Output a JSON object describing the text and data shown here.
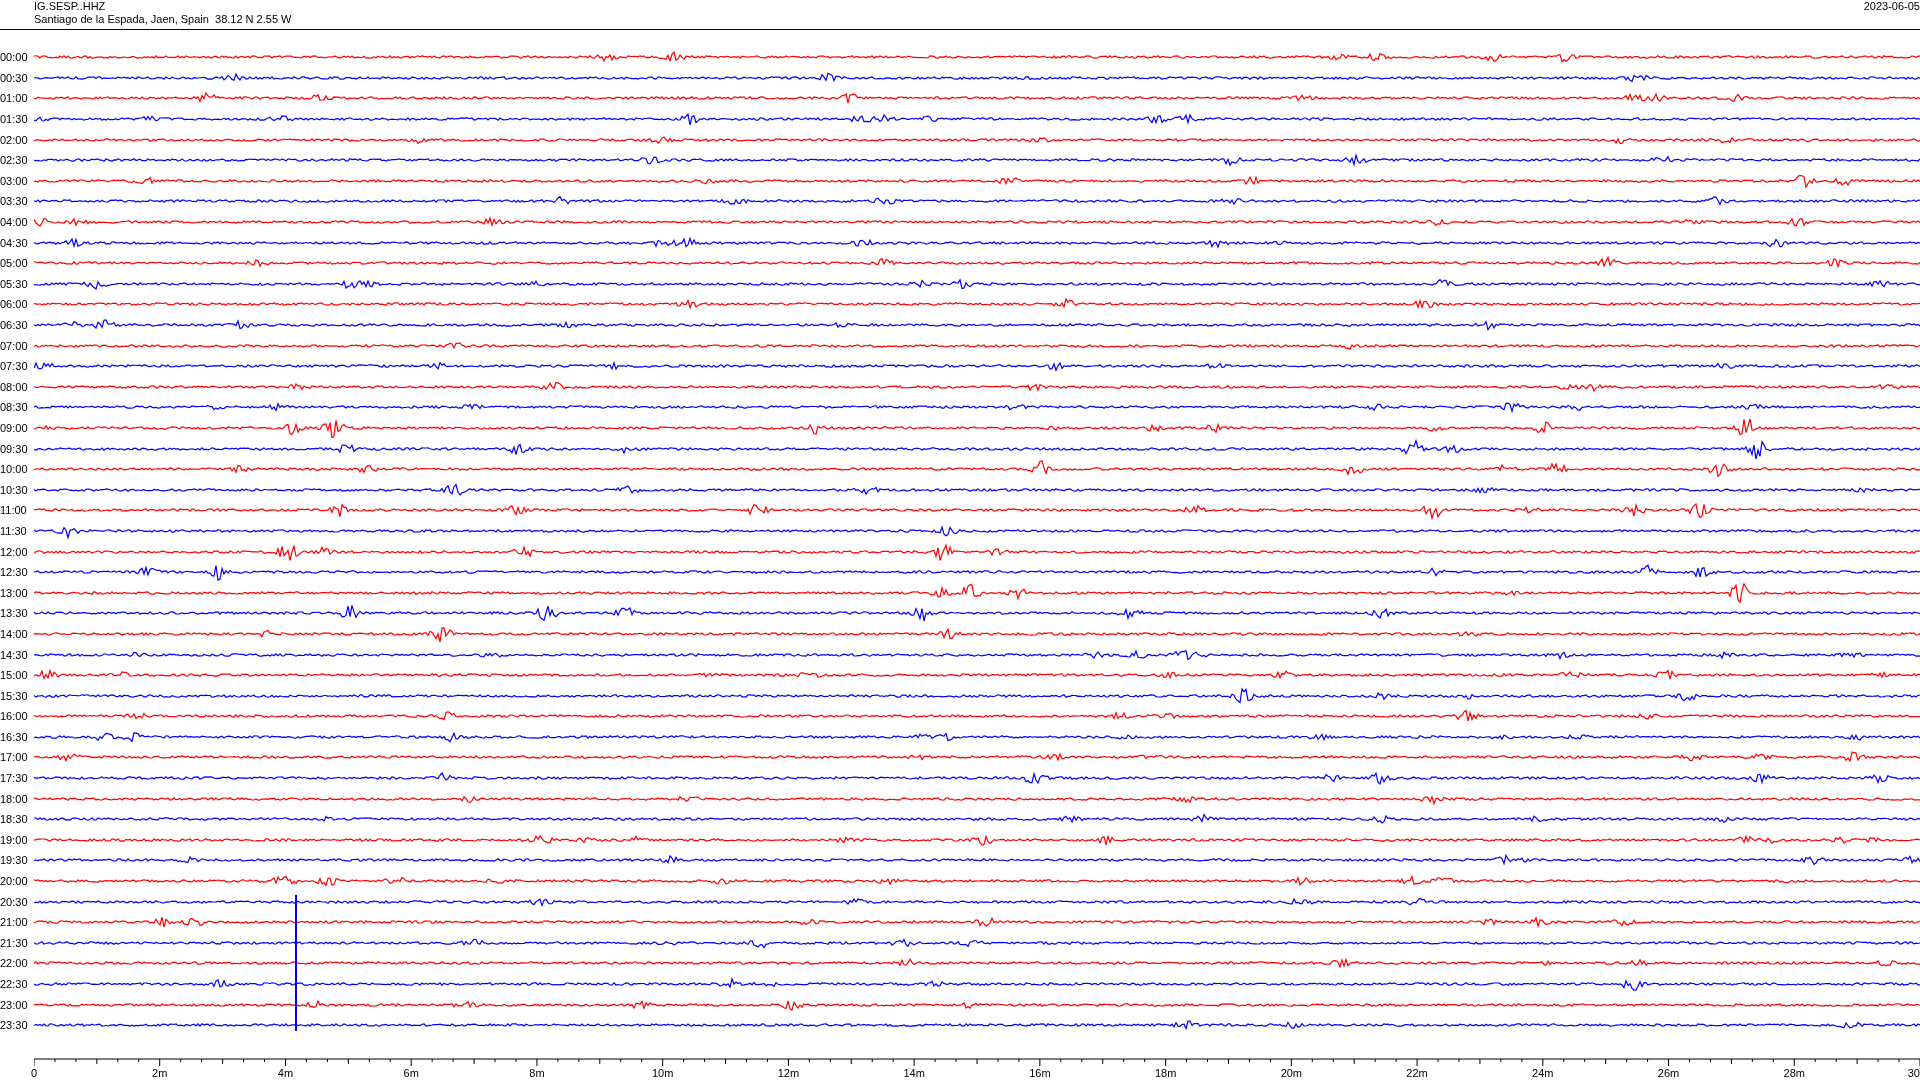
{
  "header": {
    "station": "IG.SESP..HHZ",
    "location": "Santiago de la Espada, Jaen, Spain  38.12 N 2.55 W",
    "date": "2023-06-05"
  },
  "traces": [
    {
      "label": "00:00",
      "color": "#ff0000"
    },
    {
      "label": "00:30",
      "color": "#0000ff"
    },
    {
      "label": "01:00",
      "color": "#ff0000"
    },
    {
      "label": "01:30",
      "color": "#0000ff"
    },
    {
      "label": "02:00",
      "color": "#ff0000"
    },
    {
      "label": "02:30",
      "color": "#0000ff"
    },
    {
      "label": "03:00",
      "color": "#ff0000"
    },
    {
      "label": "03:30",
      "color": "#0000ff"
    },
    {
      "label": "04:00",
      "color": "#ff0000"
    },
    {
      "label": "04:30",
      "color": "#0000ff"
    },
    {
      "label": "05:00",
      "color": "#ff0000"
    },
    {
      "label": "05:30",
      "color": "#0000ff"
    },
    {
      "label": "06:00",
      "color": "#ff0000"
    },
    {
      "label": "06:30",
      "color": "#0000ff"
    },
    {
      "label": "07:00",
      "color": "#ff0000"
    },
    {
      "label": "07:30",
      "color": "#0000ff"
    },
    {
      "label": "08:00",
      "color": "#ff0000"
    },
    {
      "label": "08:30",
      "color": "#0000ff"
    },
    {
      "label": "09:00",
      "color": "#ff0000"
    },
    {
      "label": "09:30",
      "color": "#0000ff"
    },
    {
      "label": "10:00",
      "color": "#ff0000"
    },
    {
      "label": "10:30",
      "color": "#0000ff"
    },
    {
      "label": "11:00",
      "color": "#ff0000"
    },
    {
      "label": "11:30",
      "color": "#0000ff"
    },
    {
      "label": "12:00",
      "color": "#ff0000"
    },
    {
      "label": "12:30",
      "color": "#0000ff"
    },
    {
      "label": "13:00",
      "color": "#ff0000"
    },
    {
      "label": "13:30",
      "color": "#0000ff"
    },
    {
      "label": "14:00",
      "color": "#ff0000"
    },
    {
      "label": "14:30",
      "color": "#0000ff"
    },
    {
      "label": "15:00",
      "color": "#ff0000"
    },
    {
      "label": "15:30",
      "color": "#0000ff"
    },
    {
      "label": "16:00",
      "color": "#ff0000"
    },
    {
      "label": "16:30",
      "color": "#0000ff"
    },
    {
      "label": "17:00",
      "color": "#ff0000"
    },
    {
      "label": "17:30",
      "color": "#0000ff"
    },
    {
      "label": "18:00",
      "color": "#ff0000"
    },
    {
      "label": "18:30",
      "color": "#0000ff"
    },
    {
      "label": "19:00",
      "color": "#ff0000"
    },
    {
      "label": "19:30",
      "color": "#0000ff"
    },
    {
      "label": "20:00",
      "color": "#ff0000"
    },
    {
      "label": "20:30",
      "color": "#0000ff"
    },
    {
      "label": "21:00",
      "color": "#ff0000"
    },
    {
      "label": "21:30",
      "color": "#0000ff"
    },
    {
      "label": "22:00",
      "color": "#ff0000"
    },
    {
      "label": "22:30",
      "color": "#0000ff"
    },
    {
      "label": "23:00",
      "color": "#ff0000"
    },
    {
      "label": "23:30",
      "color": "#0000ff"
    }
  ],
  "axis_labels": [
    "0",
    "2m",
    "4m",
    "6m",
    "8m",
    "10m",
    "12m",
    "14m",
    "16m",
    "18m",
    "20m",
    "22m",
    "24m",
    "26m",
    "28m",
    "30"
  ]
}
